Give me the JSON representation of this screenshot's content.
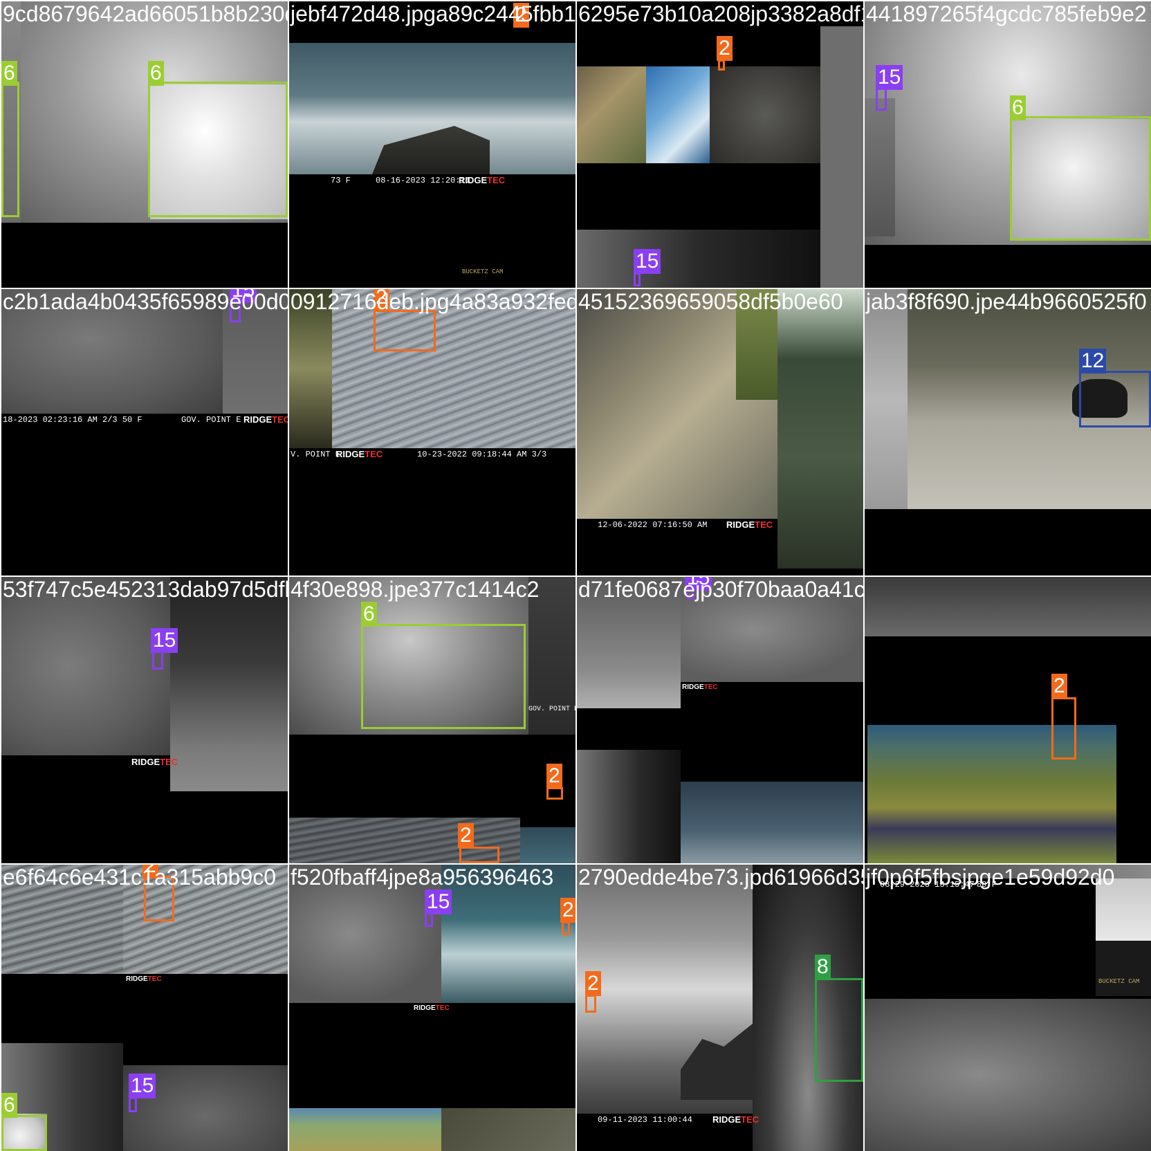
{
  "colors": {
    "class_2": "#f26b1d",
    "class_6": "#9acd32",
    "class_8": "#2ea043",
    "class_12": "#2b4aa8",
    "class_15": "#8a3ff0"
  },
  "tiles": [
    {
      "filename": "9cd8679642ad66051b8b230d6bf7223483",
      "labels": [
        "6",
        "6"
      ]
    },
    {
      "filename": "jebf472d48.jpga89c2445fbb1",
      "labels": [
        "2"
      ]
    },
    {
      "filename": "6295e73b10a208jp3382a8df1e",
      "labels": [
        "2",
        "15"
      ]
    },
    {
      "filename": "441897265f4gcdc785feb9e2",
      "labels": [
        "15",
        "6"
      ]
    },
    {
      "filename": "c2b1ada4b0435f65989e00d0",
      "labels": [
        "15"
      ]
    },
    {
      "filename": "0912716deb.jpg4a83a932fed4",
      "labels": [
        "2"
      ]
    },
    {
      "filename": "45152369659058df5b0e60",
      "labels": []
    },
    {
      "filename": "jab3f8f690.jpe44b9660525f0",
      "labels": [
        "12"
      ]
    },
    {
      "filename": "53f747c5e452313dab97d5dfb20f6d71.1214a6bef6b21fb2",
      "labels": [
        "15"
      ]
    },
    {
      "filename": "4f30e898.jpe377c1414c2",
      "labels": [
        "6",
        "2",
        "2"
      ]
    },
    {
      "filename": "d71fe0687ejp30f70baa0a41c",
      "labels": [
        "15"
      ]
    },
    {
      "filename": "",
      "labels": [
        "2"
      ]
    },
    {
      "filename": "e6f64c6e431c1a315abb9c0",
      "labels": [
        "2",
        "6",
        "15"
      ]
    },
    {
      "filename": "f520fbaff4jpe8a956396463",
      "labels": [
        "15",
        "2"
      ]
    },
    {
      "filename": "2790edde4be73.jpd61966d35",
      "labels": [
        "2",
        "8"
      ]
    },
    {
      "filename": "jf0p6f5fbsjpge1e59d92d0",
      "labels": []
    }
  ],
  "overlays": {
    "t1_stamp": "08-16-2023 12:20:11",
    "t1_temp": "73 F",
    "t4_stamp": "18-2023 02:23:16 AM      2/3      50 F",
    "t4_loc": "GOV. POINT E",
    "t5_stamp": "10-23-2022 09:18:44 AM      3/3",
    "t5_loc": "V. POINT E",
    "t6_stamp": "12-06-2022 07:16:50 AM",
    "t9_loc": "GOV. POINT E",
    "t14_stamp": "09-11-2023 11:00:44",
    "t15_stamp": "08-29-2023 13:15:47",
    "t15_temp": "80 F",
    "brand_a": "RIDGE",
    "brand_b": "TEC",
    "bucketz": "BUCKETZ CAM"
  }
}
